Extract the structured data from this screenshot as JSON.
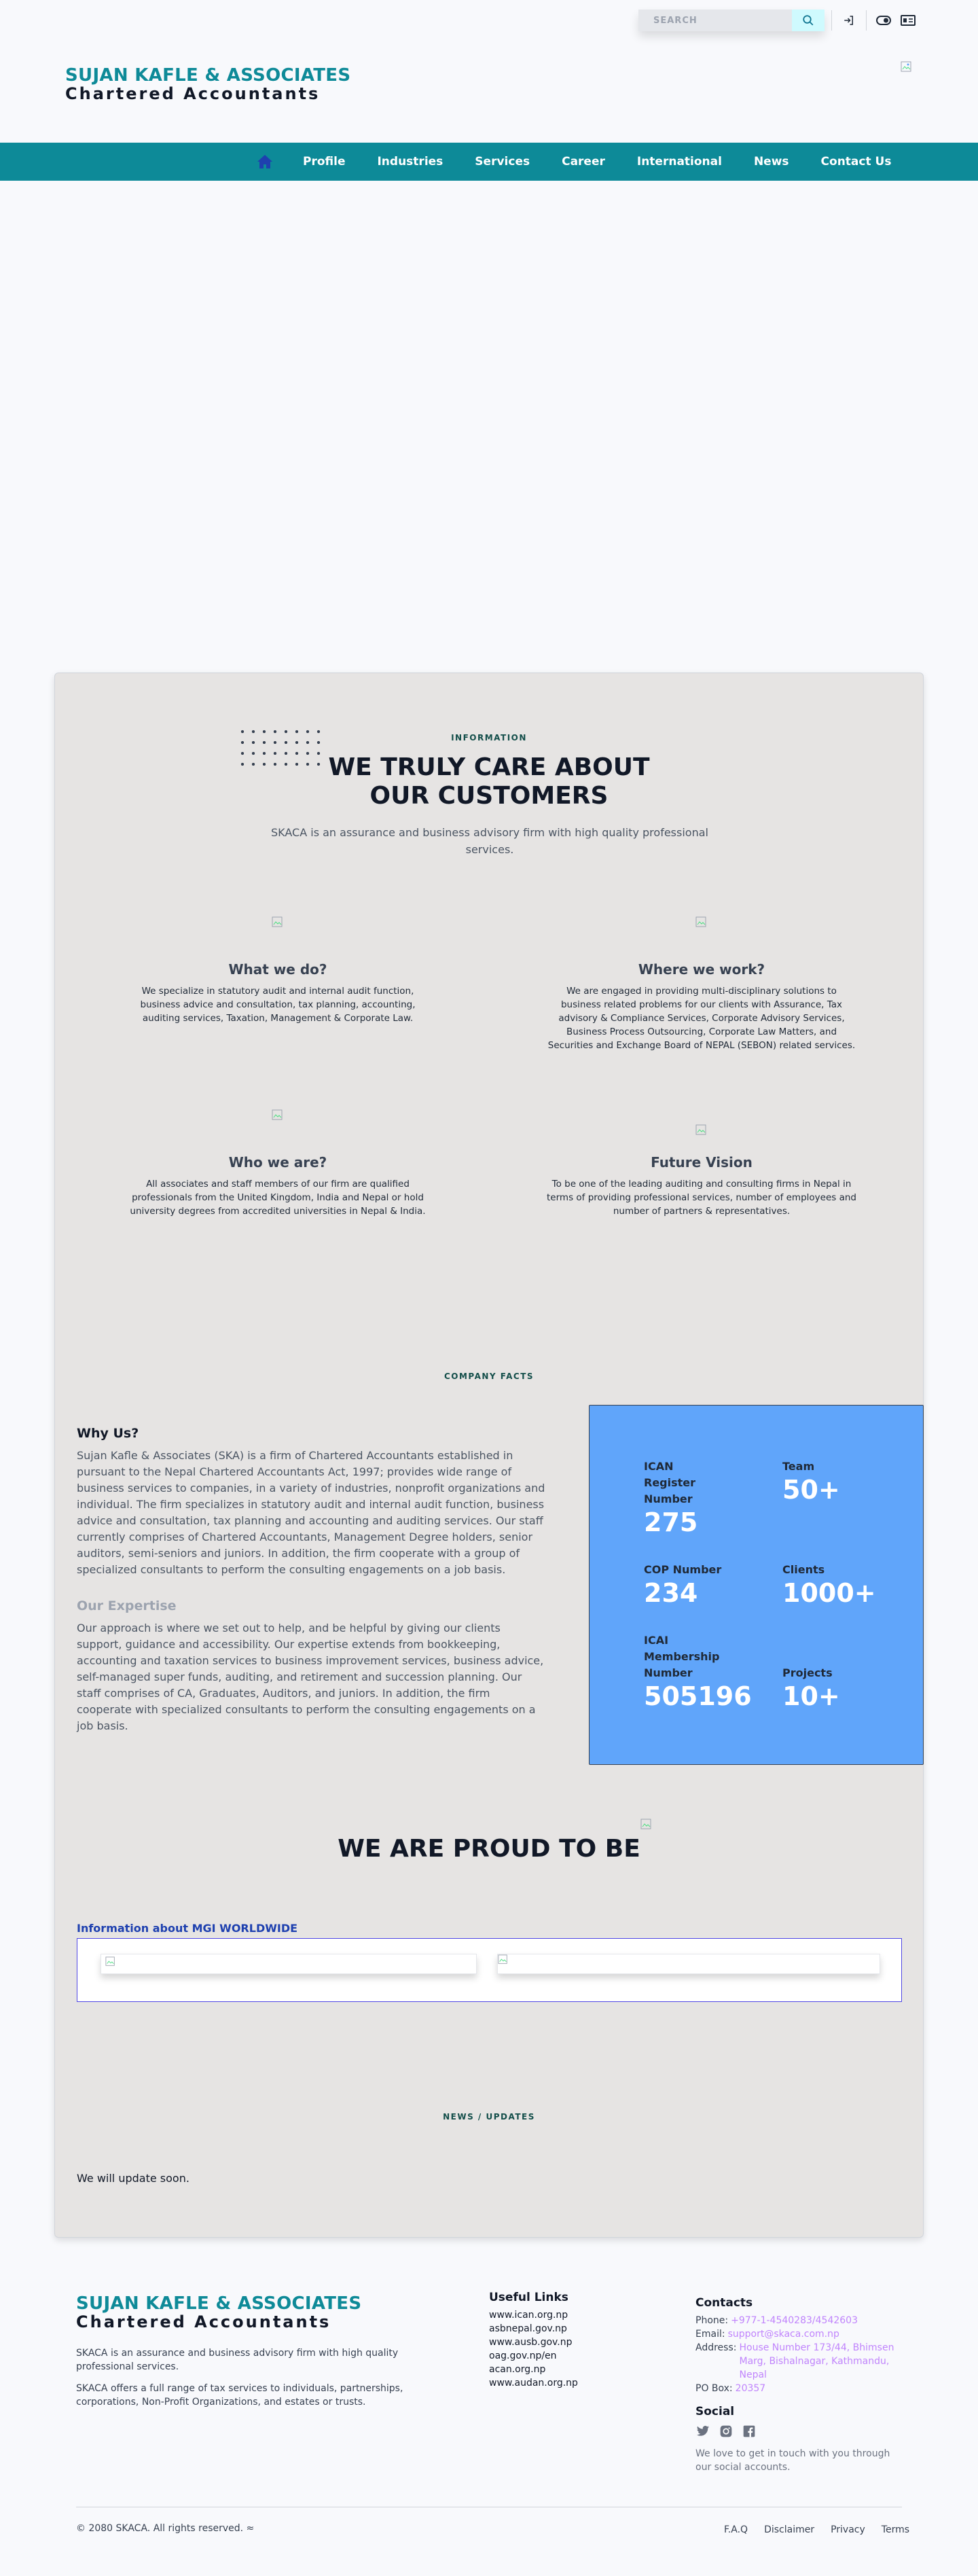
{
  "topbar": {
    "search_placeholder": "SEARCH",
    "icons": [
      "search-icon",
      "login-icon",
      "theme-toggle-icon",
      "language-icon"
    ]
  },
  "brand": {
    "name": "SUJAN KAFLE & ASSOCIATES",
    "subtitle": "Chartered Accountants"
  },
  "nav": {
    "items": [
      "Profile",
      "Industries",
      "Services",
      "Career",
      "International",
      "News",
      "Contact Us"
    ]
  },
  "info": {
    "eyebrow": "INFORMATION",
    "title_line1": "WE TRULY CARE ABOUT",
    "title_line2": "OUR CUSTOMERS",
    "description": "SKACA is an assurance and business advisory firm with high quality professional services."
  },
  "features": [
    {
      "title": "What we do?",
      "text": "We specialize in statutory audit and internal audit function, business advice and consultation, tax planning, accounting, auditing services, Taxation, Management & Corporate Law."
    },
    {
      "title": "Where we work?",
      "text": "We are engaged in providing multi-disciplinary solutions to business related problems for our clients with Assurance, Tax advisory & Compliance Services, Corporate Advisory Services, Business Process Outsourcing, Corporate Law Matters, and Securities and Exchange Board of NEPAL (SEBON) related services."
    },
    {
      "title": "Who we are?",
      "text": "All associates and staff members of our firm are qualified professionals from the United Kingdom, India and Nepal or hold university degrees from accredited universities in Nepal & India."
    },
    {
      "title": "Future Vision",
      "text": "To be one of the leading auditing and consulting firms in Nepal in terms of providing professional services, number of employees and number of partners & representatives."
    }
  ],
  "facts": {
    "eyebrow": "COMPANY FACTS",
    "why_title": "Why Us?",
    "why_text": "Sujan Kafle & Associates (SKA) is a firm of Chartered Accountants established in pursuant to the Nepal Chartered Accountants Act, 1997; provides wide range of business services to companies, in a variety of industries, nonprofit organizations and individual. The firm specializes in statutory audit and internal audit function, business advice and consultation, tax planning and accounting and auditing services. Our staff currently comprises of Chartered Accountants, Management Degree holders, senior auditors, semi-seniors and juniors. In addition, the firm cooperate with a group of specialized consultants to perform the consulting engagements on a job basis.",
    "expertise_title": "Our Expertise",
    "expertise_text": "Our approach is where we set out to help, and be helpful by giving our clients support, guidance and accessibility. Our expertise extends from bookkeeping, accounting and taxation services to business improvement services, business advice, self-managed super funds, auditing, and retirement and succession planning. Our staff comprises of CA, Graduates, Auditors, and juniors. In addition, the firm cooperate with specialized consultants to perform the consulting engagements on a job basis.",
    "stats": [
      {
        "label": "ICAN Register Number",
        "value": "275"
      },
      {
        "label": "Team",
        "value": "50+"
      },
      {
        "label": "COP Number",
        "value": "234"
      },
      {
        "label": "Clients",
        "value": "1000+"
      },
      {
        "label": "ICAI Membership Number",
        "value": "505196"
      },
      {
        "label": "Projects",
        "value": "10+"
      }
    ]
  },
  "proud": {
    "title": "WE ARE PROUD TO BE",
    "mgi_link": "Information about MGI WORLDWIDE"
  },
  "news": {
    "eyebrow": "NEWS / UPDATES",
    "text": "We will update soon."
  },
  "footer": {
    "brand_name": "SUJAN KAFLE & ASSOCIATES",
    "brand_subtitle": "Chartered Accountants",
    "about1": "SKACA is an assurance and business advisory firm with high quality professional services.",
    "about2": "SKACA offers a full range of tax services to individuals, partnerships, corporations, Non-Profit Organizations, and estates or trusts.",
    "useful_title": "Useful Links",
    "useful_links": [
      "www.ican.org.np",
      "asbnepal.gov.np",
      "www.ausb.gov.np",
      "oag.gov.np/en",
      "acan.org.np",
      "www.audan.org.np"
    ],
    "contacts_title": "Contacts",
    "phone_label": "Phone:",
    "phone": "+977-1-4540283/4542603",
    "email_label": "Email:",
    "email": "support@skaca.com.np",
    "address_label": "Address:",
    "address": "House Number 173/44, Bhimsen Marg, Bishalnagar, Kathmandu, Nepal",
    "pobox_label": "PO Box:",
    "pobox": "20357",
    "social_title": "Social",
    "social_note": "We love to get in touch with you through our social accounts.",
    "copyright": "© 2080 SKACA. All rights reserved. ≈",
    "links": [
      "F.A.Q",
      "Disclaimer",
      "Privacy",
      "Terms"
    ]
  },
  "colors": {
    "brand_teal": "#0e8a98",
    "nav_bg": "#0d8a98",
    "stats_bg": "#60a5fa",
    "link_purple": "#c084fc"
  }
}
